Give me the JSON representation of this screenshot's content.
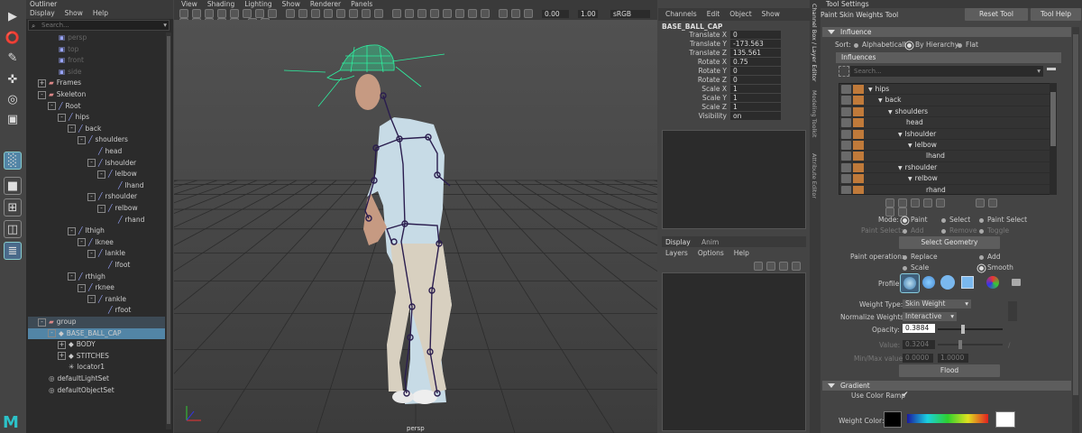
{
  "outliner": {
    "title": "Outliner",
    "menu": [
      "Display",
      "Show",
      "Help"
    ],
    "search_placeholder": "Search...",
    "rows": [
      {
        "label": "persp",
        "depth": 2,
        "type": "cam",
        "dim": true
      },
      {
        "label": "top",
        "depth": 2,
        "type": "cam",
        "dim": true
      },
      {
        "label": "front",
        "depth": 2,
        "type": "cam",
        "dim": true
      },
      {
        "label": "side",
        "depth": 2,
        "type": "cam",
        "dim": true
      },
      {
        "label": "Frames",
        "depth": 1,
        "type": "grp",
        "tw": "+"
      },
      {
        "label": "Skeleton",
        "depth": 1,
        "type": "grp",
        "tw": "-"
      },
      {
        "label": "Root",
        "depth": 2,
        "type": "jnt",
        "tw": "-"
      },
      {
        "label": "hips",
        "depth": 3,
        "type": "jnt",
        "tw": "-"
      },
      {
        "label": "back",
        "depth": 4,
        "type": "jnt",
        "tw": "-"
      },
      {
        "label": "shoulders",
        "depth": 5,
        "type": "jnt",
        "tw": "-"
      },
      {
        "label": "head",
        "depth": 6,
        "type": "jnt"
      },
      {
        "label": "lshoulder",
        "depth": 6,
        "type": "jnt",
        "tw": "-"
      },
      {
        "label": "lelbow",
        "depth": 7,
        "type": "jnt",
        "tw": "-"
      },
      {
        "label": "lhand",
        "depth": 8,
        "type": "jnt"
      },
      {
        "label": "rshoulder",
        "depth": 6,
        "type": "jnt",
        "tw": "-"
      },
      {
        "label": "relbow",
        "depth": 7,
        "type": "jnt",
        "tw": "-"
      },
      {
        "label": "rhand",
        "depth": 8,
        "type": "jnt"
      },
      {
        "label": "lthigh",
        "depth": 4,
        "type": "jnt",
        "tw": "-"
      },
      {
        "label": "lknee",
        "depth": 5,
        "type": "jnt",
        "tw": "-"
      },
      {
        "label": "lankle",
        "depth": 6,
        "type": "jnt",
        "tw": "-"
      },
      {
        "label": "lfoot",
        "depth": 7,
        "type": "jnt"
      },
      {
        "label": "rthigh",
        "depth": 4,
        "type": "jnt",
        "tw": "-"
      },
      {
        "label": "rknee",
        "depth": 5,
        "type": "jnt",
        "tw": "-"
      },
      {
        "label": "rankle",
        "depth": 6,
        "type": "jnt",
        "tw": "-"
      },
      {
        "label": "rfoot",
        "depth": 7,
        "type": "jnt"
      },
      {
        "label": "group",
        "depth": 1,
        "type": "grp",
        "tw": "-",
        "hl": "group"
      },
      {
        "label": "BASE_BALL_CAP",
        "depth": 2,
        "type": "mesh",
        "tw": "-",
        "hl": "sel"
      },
      {
        "label": "BODY",
        "depth": 3,
        "type": "mesh",
        "tw": "+"
      },
      {
        "label": "STITCHES",
        "depth": 3,
        "type": "mesh",
        "tw": "+"
      },
      {
        "label": "locator1",
        "depth": 3,
        "type": "loc"
      },
      {
        "label": "defaultLightSet",
        "depth": 1,
        "type": "set"
      },
      {
        "label": "defaultObjectSet",
        "depth": 1,
        "type": "set"
      }
    ]
  },
  "viewport": {
    "menu": [
      "View",
      "Shading",
      "Lighting",
      "Show",
      "Renderer",
      "Panels"
    ],
    "exposure": "0.00",
    "gamma": "1.00",
    "colorspace": "sRGB gamma",
    "camera": "persp"
  },
  "channelbox": {
    "menu": [
      "Channels",
      "Edit",
      "Object",
      "Show"
    ],
    "object": "BASE_BALL_CAP",
    "attrs": [
      {
        "k": "Translate X",
        "v": "0"
      },
      {
        "k": "Translate Y",
        "v": "-173.563"
      },
      {
        "k": "Translate Z",
        "v": "135.561"
      },
      {
        "k": "Rotate X",
        "v": "0.75"
      },
      {
        "k": "Rotate Y",
        "v": "0"
      },
      {
        "k": "Rotate Z",
        "v": "0"
      },
      {
        "k": "Scale X",
        "v": "1"
      },
      {
        "k": "Scale Y",
        "v": "1"
      },
      {
        "k": "Scale Z",
        "v": "1"
      },
      {
        "k": "Visibility",
        "v": "on"
      }
    ]
  },
  "layers": {
    "tabs": [
      "Display",
      "Anim"
    ],
    "menu": [
      "Layers",
      "Options",
      "Help"
    ]
  },
  "sidetabs": [
    "Channel Box / Layer Editor",
    "Modeling Toolkit",
    "Attribute Editor"
  ],
  "tool": {
    "header": "Tool Settings",
    "name": "Paint Skin Weights Tool",
    "reset": "Reset Tool",
    "help": "Tool Help",
    "influence_section": "Influence",
    "sort_label": "Sort:",
    "sort_opts": [
      "Alphabetically",
      "By Hierarchy",
      "Flat"
    ],
    "influences_section": "Influences",
    "search_placeholder": "Search...",
    "inf_rows": [
      {
        "n": "hips",
        "d": 0,
        "t": "v"
      },
      {
        "n": "back",
        "d": 1,
        "t": "v"
      },
      {
        "n": "shoulders",
        "d": 2,
        "t": "v"
      },
      {
        "n": "head",
        "d": 3
      },
      {
        "n": "lshoulder",
        "d": 3,
        "t": "v"
      },
      {
        "n": "lelbow",
        "d": 4,
        "t": "v"
      },
      {
        "n": "lhand",
        "d": 5
      },
      {
        "n": "rshoulder",
        "d": 3,
        "t": "v"
      },
      {
        "n": "relbow",
        "d": 4,
        "t": "v"
      },
      {
        "n": "rhand",
        "d": 5
      }
    ],
    "mode_label": "Mode:",
    "mode_opts": [
      "Paint",
      "Select",
      "Paint Select"
    ],
    "paintsel_label": "Paint Select:",
    "paintsel_opts": [
      "Add",
      "Remove",
      "Toggle"
    ],
    "select_geometry": "Select Geometry",
    "paintop_label": "Paint operation:",
    "paintop_opts": [
      "Replace",
      "Add",
      "Scale",
      "Smooth"
    ],
    "profile_label": "Profile:",
    "weight_type_label": "Weight Type:",
    "weight_type": "Skin Weight",
    "normalize_label": "Normalize Weights:",
    "normalize": "Interactive",
    "opacity_label": "Opacity:",
    "opacity": "0.3884",
    "value_label": "Value:",
    "value": "0.3204",
    "minmax_label": "Min/Max value:",
    "min": "0.0000",
    "max": "1.0000",
    "flood": "Flood",
    "gradient_section": "Gradient",
    "color_ramp_label": "Use Color Ramp",
    "weight_color_label": "Weight Color:"
  },
  "colors": {
    "selection": "#5285a6",
    "skeleton": "#2a1d4e",
    "cap": "#2ef0a0",
    "joint_color": "#c07a3a"
  }
}
